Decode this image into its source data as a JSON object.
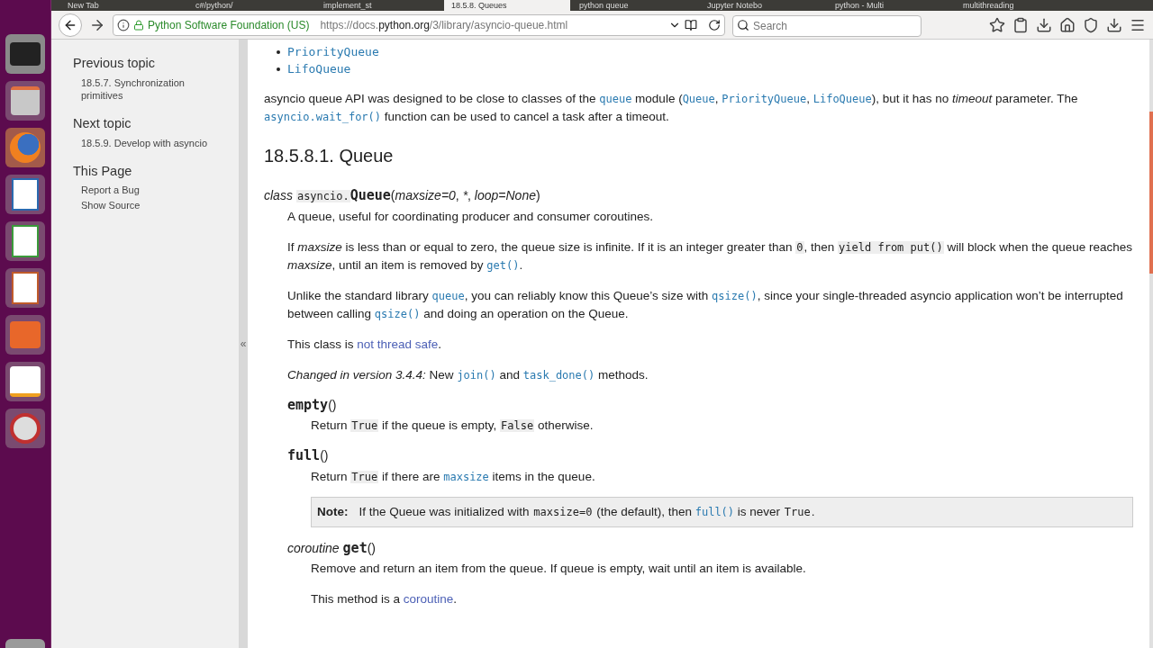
{
  "tabs": [
    {
      "title": "New Tab",
      "selected": false
    },
    {
      "title": "c#/python/",
      "selected": false
    },
    {
      "title": "implement_st",
      "selected": false
    },
    {
      "title": "18.5.8. Queues",
      "selected": true
    },
    {
      "title": "python queue",
      "selected": false
    },
    {
      "title": "Jupyter Notebo",
      "selected": false
    },
    {
      "title": "python - Multi",
      "selected": false
    },
    {
      "title": "multithreading",
      "selected": false
    }
  ],
  "address_bar": {
    "identity": "Python Software Foundation (US)",
    "url_prefix": "https://docs.",
    "url_domain": "python.org",
    "url_path": "/3/library/asyncio-queue.html"
  },
  "search": {
    "placeholder": "Search"
  },
  "sidebar": {
    "sections": [
      {
        "heading": "Previous topic",
        "links": [
          "18.5.7. Synchronization primitives"
        ]
      },
      {
        "heading": "Next topic",
        "links": [
          "18.5.9. Develop with asyncio"
        ]
      },
      {
        "heading": "This Page",
        "links": [
          "Report a Bug",
          "Show Source"
        ]
      }
    ],
    "collapse": "«"
  },
  "list": [
    "PriorityQueue",
    "LifoQueue"
  ],
  "blocks": [
    {
      "kind": "para",
      "parts": [
        {
          "kind": "text",
          "text": "asyncio queue API was designed to be close to classes of the "
        },
        {
          "kind": "link_code",
          "text": "queue"
        },
        {
          "kind": "text",
          "text": " module ("
        },
        {
          "kind": "link_code",
          "text": "Queue"
        },
        {
          "kind": "text",
          "text": ", "
        },
        {
          "kind": "link_code",
          "text": "PriorityQueue"
        },
        {
          "kind": "text",
          "text": ", "
        },
        {
          "kind": "link_code",
          "text": "LifoQueue"
        },
        {
          "kind": "text",
          "text": "), but it has no "
        },
        {
          "kind": "em",
          "text": "timeout"
        },
        {
          "kind": "text",
          "text": " parameter. The "
        },
        {
          "kind": "link_code",
          "text": "asyncio.wait_for()"
        },
        {
          "kind": "text",
          "text": " function can be used to cancel a task after a timeout."
        }
      ]
    },
    {
      "kind": "heading",
      "text": "18.5.8.1. Queue"
    },
    {
      "kind": "signature",
      "parts": [
        {
          "kind": "em",
          "text": "class"
        },
        {
          "kind": "code",
          "text": "asyncio."
        },
        {
          "kind": "name",
          "text": "Queue"
        },
        {
          "kind": "text",
          "text": "("
        },
        {
          "kind": "em",
          "text": "maxsize=0"
        },
        {
          "kind": "text",
          "text": ", "
        },
        {
          "kind": "em",
          "text": "*"
        },
        {
          "kind": "text",
          "text": ", "
        },
        {
          "kind": "em",
          "text": "loop=None"
        },
        {
          "kind": "text",
          "text": ")"
        }
      ],
      "children": [
        {
          "kind": "para",
          "parts": [
            {
              "kind": "text",
              "text": "A queue, useful for coordinating producer and consumer coroutines."
            }
          ]
        },
        {
          "kind": "para",
          "parts": [
            {
              "kind": "text",
              "text": "If "
            },
            {
              "kind": "em",
              "text": "maxsize"
            },
            {
              "kind": "text",
              "text": " is less than or equal to zero, the queue size is infinite. If it is an integer greater than "
            },
            {
              "kind": "code",
              "text": "0"
            },
            {
              "kind": "text",
              "text": ", then "
            },
            {
              "kind": "code",
              "text": "yield from put()"
            },
            {
              "kind": "text",
              "text": " will block when the queue reaches "
            },
            {
              "kind": "em",
              "text": "maxsize"
            },
            {
              "kind": "text",
              "text": ", until an item is removed by "
            },
            {
              "kind": "link_code",
              "text": "get()"
            },
            {
              "kind": "text",
              "text": "."
            }
          ]
        },
        {
          "kind": "para",
          "parts": [
            {
              "kind": "text",
              "text": "Unlike the standard library "
            },
            {
              "kind": "link_code",
              "text": "queue"
            },
            {
              "kind": "text",
              "text": ", you can reliably know this Queue’s size with "
            },
            {
              "kind": "link_code",
              "text": "qsize()"
            },
            {
              "kind": "text",
              "text": ", since your single-threaded asyncio application won’t be interrupted between calling "
            },
            {
              "kind": "link_code",
              "text": "qsize()"
            },
            {
              "kind": "text",
              "text": " and doing an operation on the Queue."
            }
          ]
        },
        {
          "kind": "para",
          "parts": [
            {
              "kind": "text",
              "text": "This class is "
            },
            {
              "kind": "link",
              "text": "not thread safe"
            },
            {
              "kind": "text",
              "text": "."
            }
          ]
        },
        {
          "kind": "para",
          "parts": [
            {
              "kind": "em",
              "text": "Changed in version 3.4.4:"
            },
            {
              "kind": "text",
              "text": " New "
            },
            {
              "kind": "link_code",
              "text": "join()"
            },
            {
              "kind": "text",
              "text": " and "
            },
            {
              "kind": "link_code",
              "text": "task_done()"
            },
            {
              "kind": "text",
              "text": " methods."
            }
          ]
        },
        {
          "kind": "signature",
          "parts": [
            {
              "kind": "name",
              "text": "empty"
            },
            {
              "kind": "text",
              "text": "()"
            }
          ],
          "children": [
            {
              "kind": "para",
              "parts": [
                {
                  "kind": "text",
                  "text": "Return "
                },
                {
                  "kind": "code",
                  "text": "True"
                },
                {
                  "kind": "text",
                  "text": " if the queue is empty, "
                },
                {
                  "kind": "code",
                  "text": "False"
                },
                {
                  "kind": "text",
                  "text": " otherwise."
                }
              ]
            }
          ]
        },
        {
          "kind": "signature",
          "parts": [
            {
              "kind": "name",
              "text": "full"
            },
            {
              "kind": "text",
              "text": "()"
            }
          ],
          "children": [
            {
              "kind": "para",
              "parts": [
                {
                  "kind": "text",
                  "text": "Return "
                },
                {
                  "kind": "code",
                  "text": "True"
                },
                {
                  "kind": "text",
                  "text": " if there are "
                },
                {
                  "kind": "link_code",
                  "text": "maxsize"
                },
                {
                  "kind": "text",
                  "text": " items in the queue."
                }
              ]
            },
            {
              "kind": "note",
              "label": "Note:",
              "parts": [
                {
                  "kind": "text",
                  "text": "If the Queue was initialized with "
                },
                {
                  "kind": "code",
                  "text": "maxsize=0"
                },
                {
                  "kind": "text",
                  "text": " (the default), then "
                },
                {
                  "kind": "link_code",
                  "text": "full()"
                },
                {
                  "kind": "text",
                  "text": " is never "
                },
                {
                  "kind": "code",
                  "text": "True"
                },
                {
                  "kind": "text",
                  "text": "."
                }
              ]
            }
          ]
        },
        {
          "kind": "signature",
          "parts": [
            {
              "kind": "em",
              "text": "coroutine"
            },
            {
              "kind": "name",
              "text": "get"
            },
            {
              "kind": "text",
              "text": "()"
            }
          ],
          "children": [
            {
              "kind": "para",
              "parts": [
                {
                  "kind": "text",
                  "text": "Remove and return an item from the queue. If queue is empty, wait until an item is available."
                }
              ]
            },
            {
              "kind": "para",
              "parts": [
                {
                  "kind": "text",
                  "text": "This method is a "
                },
                {
                  "kind": "link",
                  "text": "coroutine"
                },
                {
                  "kind": "text",
                  "text": "."
                }
              ]
            }
          ]
        }
      ]
    }
  ]
}
